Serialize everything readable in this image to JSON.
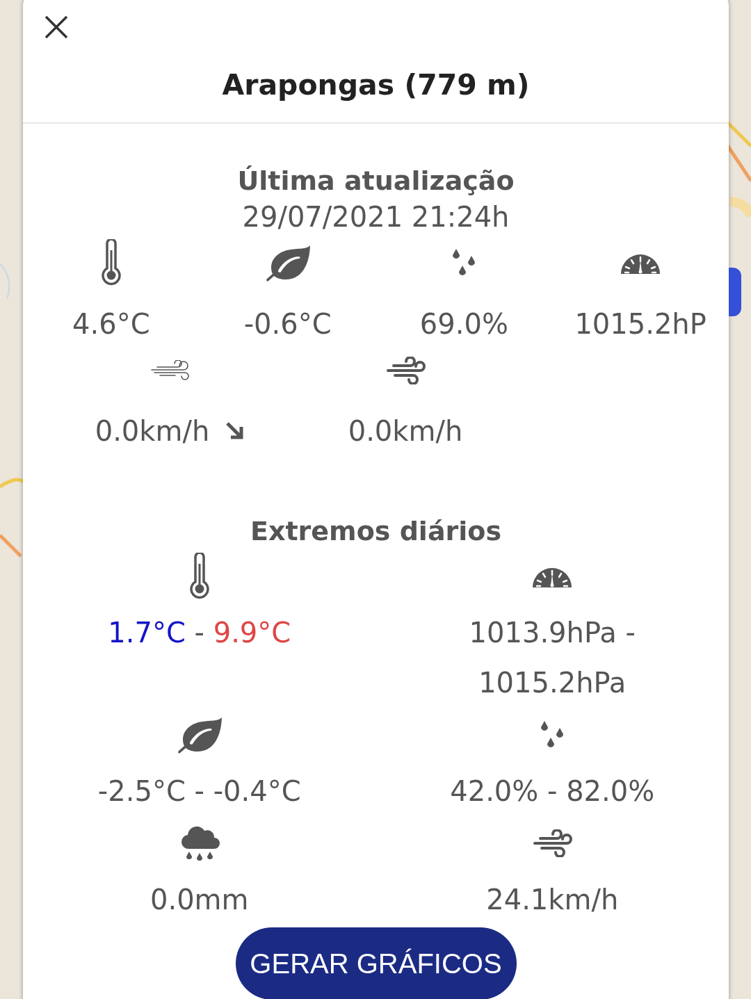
{
  "title": "Arapongas (779 m)",
  "current": {
    "heading": "Última atualização",
    "timestamp": "29/07/2021 21:24h",
    "readings": [
      {
        "kind": "temperature",
        "value": "4.6°C"
      },
      {
        "kind": "dew_point",
        "value": "-0.6°C"
      },
      {
        "kind": "humidity",
        "value": "69.0%"
      },
      {
        "kind": "pressure",
        "value": "1015.2hP"
      }
    ],
    "wind": [
      {
        "kind": "wind_speed",
        "value": "0.0km/h"
      },
      {
        "kind": "gust",
        "value": "0.0km/h"
      }
    ]
  },
  "extremes": {
    "heading": "Extremos diários",
    "items": [
      {
        "kind": "temperature_range",
        "min": {
          "value": "1.7°C",
          "color": "#1414c8"
        },
        "separator": "-",
        "max": {
          "value": "9.9°C",
          "color": "#e04444"
        }
      },
      {
        "kind": "pressure",
        "value": "1013.9hPa - 1015.2hPa"
      },
      {
        "kind": "dew_point",
        "value": "-2.5°C - -0.4°C"
      },
      {
        "kind": "humidity",
        "value": "42.0% - 82.0%"
      },
      {
        "kind": "rain",
        "value": "0.0mm"
      },
      {
        "kind": "gust",
        "value": "24.1km/h"
      }
    ]
  },
  "button": "GERAR GRÁFICOS"
}
